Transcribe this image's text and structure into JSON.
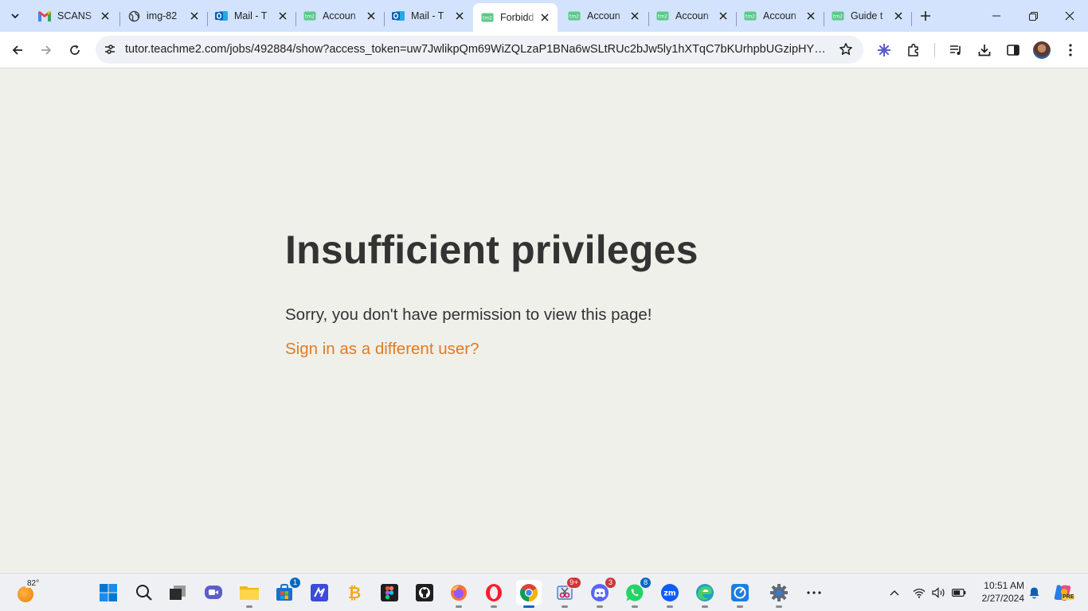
{
  "browser": {
    "tabs": [
      {
        "title": "SCANS",
        "favicon": "gmail-icon",
        "active": false
      },
      {
        "title": "img-82",
        "favicon": "globe-icon",
        "active": false
      },
      {
        "title": "Mail - T",
        "favicon": "outlook-icon",
        "active": false
      },
      {
        "title": "Accoun",
        "favicon": "tm2-icon",
        "active": false
      },
      {
        "title": "Mail - T",
        "favicon": "outlook-icon",
        "active": false
      },
      {
        "title": "Forbidd",
        "favicon": "tm2-icon",
        "active": true
      },
      {
        "title": "Accoun",
        "favicon": "tm2-icon",
        "active": false
      },
      {
        "title": "Accoun",
        "favicon": "tm2-icon",
        "active": false
      },
      {
        "title": "Accoun",
        "favicon": "tm2-icon",
        "active": false
      },
      {
        "title": "Guide t",
        "favicon": "tm2-icon",
        "active": false
      }
    ],
    "url": "tutor.teachme2.com/jobs/492884/show?access_token=uw7JwlikpQm69WiZQLzaP1BNa6wSLtRUc2bJw5ly1hXTqC7bKUrhpbUGzipHYmJkGPhhYj..."
  },
  "page": {
    "title": "Insufficient privileges",
    "message": "Sorry, you don't have permission to view this page!",
    "link": "Sign in as a different user?"
  },
  "taskbar": {
    "weather_temp": "82°",
    "apps": [
      {
        "name": "start-button",
        "badge": ""
      },
      {
        "name": "search-button",
        "badge": ""
      },
      {
        "name": "task-view-button",
        "badge": ""
      },
      {
        "name": "meet-app",
        "badge": ""
      },
      {
        "name": "file-explorer-app",
        "badge": ""
      },
      {
        "name": "store-app",
        "badge": "1"
      },
      {
        "name": "vscode-like-app",
        "badge": ""
      },
      {
        "name": "bitcoin-app",
        "badge": ""
      },
      {
        "name": "figma-app",
        "badge": ""
      },
      {
        "name": "github-app",
        "badge": ""
      },
      {
        "name": "firefox-app",
        "badge": ""
      },
      {
        "name": "opera-app",
        "badge": ""
      },
      {
        "name": "chrome-app",
        "badge": ""
      },
      {
        "name": "snipping-app",
        "badge": "9+"
      },
      {
        "name": "discord-app",
        "badge": "3"
      },
      {
        "name": "whatsapp-app",
        "badge": "8"
      },
      {
        "name": "zoom-app",
        "badge": ""
      },
      {
        "name": "edge-app",
        "badge": ""
      },
      {
        "name": "capture-app",
        "badge": ""
      },
      {
        "name": "settings-app",
        "badge": ""
      },
      {
        "name": "more-apps",
        "badge": ""
      }
    ],
    "clock_time": "10:51 AM",
    "clock_date": "2/27/2024",
    "copilot_label": "PRE"
  },
  "colors": {
    "tabstrip": "#d3e3fd",
    "page_bg": "#f0f0eb",
    "heading": "#333333",
    "link": "#e07b22"
  }
}
